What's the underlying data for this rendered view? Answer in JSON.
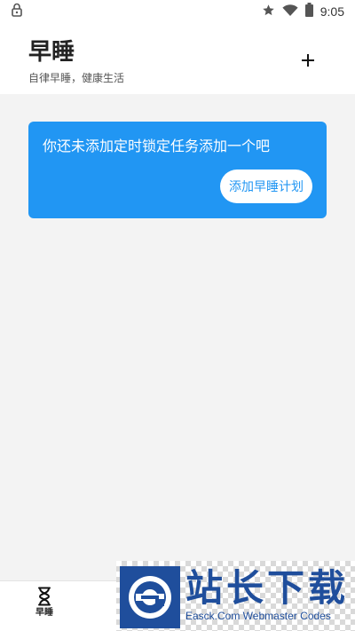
{
  "status_bar": {
    "time": "9:05",
    "icons": [
      "lock-icon",
      "star-icon",
      "wifi-icon",
      "battery-icon"
    ]
  },
  "header": {
    "title": "早睡",
    "subtitle": "自律早睡，健康生活",
    "add_icon": "plus-icon"
  },
  "empty_state": {
    "message": "你还未添加定时锁定任务添加一个吧",
    "button_label": "添加早睡计划"
  },
  "bottom_nav": {
    "items": [
      {
        "label": "早睡",
        "icon": "hourglass-icon",
        "active": true
      }
    ]
  },
  "watermark": {
    "title": "站长下载",
    "subtitle": "Easck.Com Webmaster Codes",
    "logo": "easck-logo"
  },
  "colors": {
    "accent": "#2196f3",
    "background": "#f3f3f3",
    "surface": "#ffffff",
    "watermark_blue": "#1f4e9c"
  }
}
